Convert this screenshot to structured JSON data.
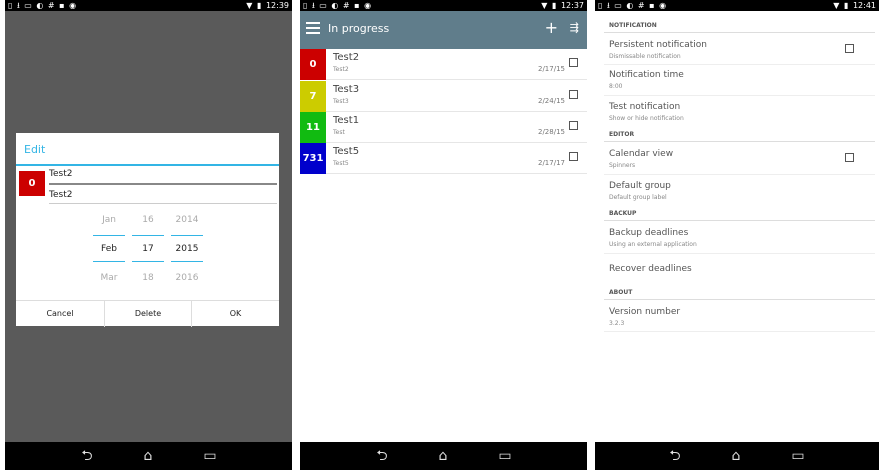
{
  "status": {
    "left_icons": "▯ ⭳ ▭ ◐ # ▪ ◉",
    "wifi_icon": "▼",
    "battery_icon": "▮",
    "p1_time": "12:39",
    "p2_time": "12:37",
    "p3_time": "12:41"
  },
  "nav": {
    "back": "⮌",
    "home": "⌂",
    "recent": "▭"
  },
  "panel1": {
    "dialog_title": "Edit",
    "badge": "0",
    "name_value": "Test2",
    "group_value": "Test2",
    "picker": {
      "month": {
        "prev": "Jan",
        "current": "Feb",
        "next": "Mar"
      },
      "day": {
        "prev": "16",
        "current": "17",
        "next": "18"
      },
      "year": {
        "prev": "2014",
        "current": "2015",
        "next": "2016"
      }
    },
    "buttons": {
      "cancel": "Cancel",
      "delete": "Delete",
      "ok": "OK"
    }
  },
  "panel2": {
    "title": "In progress",
    "add_icon": "+",
    "filter_icon": "⇶",
    "items": [
      {
        "badge": "0",
        "color": "#cc0000",
        "title": "Test2",
        "group": "Test2",
        "date": "2/17/15"
      },
      {
        "badge": "7",
        "color": "#cccc00",
        "title": "Test3",
        "group": "Test3",
        "date": "2/24/15"
      },
      {
        "badge": "11",
        "color": "#11bb11",
        "title": "Test1",
        "group": "Test",
        "date": "2/28/15"
      },
      {
        "badge": "731",
        "color": "#0000cc",
        "title": "Test5",
        "group": "Test5",
        "date": "2/17/17"
      }
    ]
  },
  "panel3": {
    "sections": {
      "notification": "NOTIFICATION",
      "editor": "EDITOR",
      "backup": "BACKUP",
      "about": "ABOUT"
    },
    "persistent": {
      "title": "Persistent notification",
      "sub": "Dismissable notification"
    },
    "time": {
      "title": "Notification time",
      "sub": "8:00"
    },
    "test": {
      "title": "Test notification",
      "sub": "Show or hide notification"
    },
    "calendar": {
      "title": "Calendar view",
      "sub": "Spinners"
    },
    "default_group": {
      "title": "Default group",
      "sub": "Default group label"
    },
    "backup_deadlines": {
      "title": "Backup deadlines",
      "sub": "Using an external application"
    },
    "recover": {
      "title": "Recover deadlines"
    },
    "version": {
      "title": "Version number",
      "sub": "3.2.3"
    }
  },
  "colors": {
    "accent": "#33b5e5",
    "appbar": "#607d8b"
  }
}
